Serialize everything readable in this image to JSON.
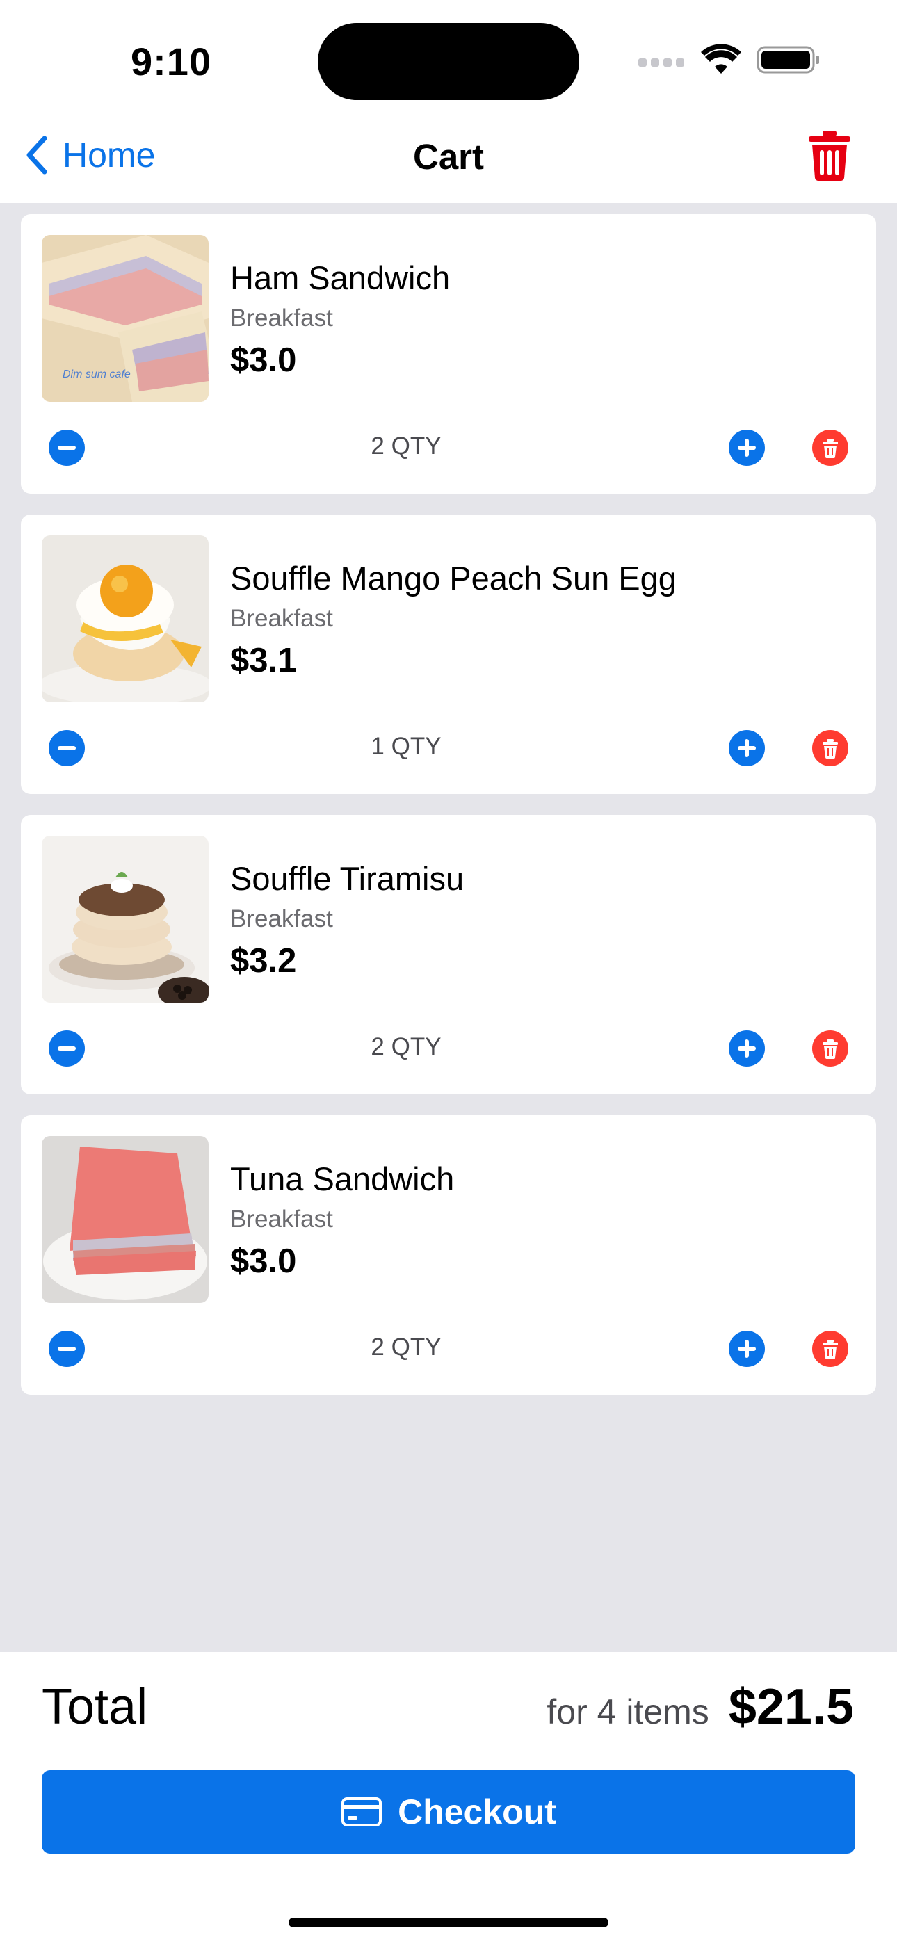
{
  "status_bar": {
    "time": "9:10"
  },
  "nav": {
    "back_label": "Home",
    "title": "Cart"
  },
  "colors": {
    "accent": "#0a73e8",
    "danger": "#ff3b30",
    "trash_nav": "#e60012"
  },
  "items": [
    {
      "name": "Ham Sandwich",
      "category": "Breakfast",
      "price": "$3.0",
      "qty": "2 QTY",
      "image": "ham-sandwich-photo",
      "image_text": "Dim sum cafe"
    },
    {
      "name": "Souffle Mango Peach Sun Egg",
      "category": "Breakfast",
      "price": "$3.1",
      "qty": "1 QTY",
      "image": "souffle-mango-photo"
    },
    {
      "name": "Souffle Tiramisu",
      "category": "Breakfast",
      "price": "$3.2",
      "qty": "2 QTY",
      "image": "souffle-tiramisu-photo"
    },
    {
      "name": "Tuna Sandwich",
      "category": "Breakfast",
      "price": "$3.0",
      "qty": "2 QTY",
      "image": "tuna-sandwich-photo"
    }
  ],
  "summary": {
    "total_label": "Total",
    "items_text": "for 4 items",
    "total": "$21.5"
  },
  "checkout": {
    "label": "Checkout",
    "icon": "credit-card-icon"
  }
}
